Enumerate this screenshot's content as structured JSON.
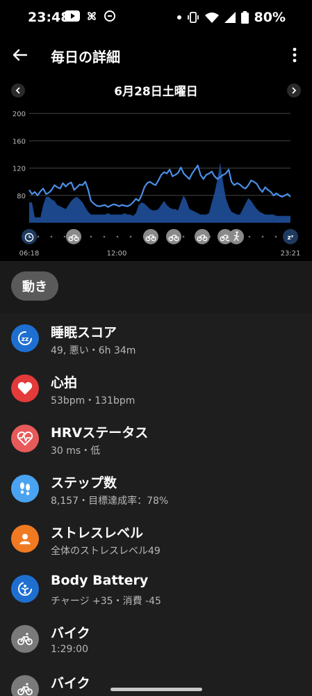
{
  "status_bar": {
    "time": "23:48",
    "battery": "80%"
  },
  "app_bar": {
    "title": "毎日の詳細"
  },
  "date": {
    "label": "6月28日土曜日"
  },
  "chart_data": {
    "type": "area",
    "y_ticks": [
      "200",
      "160",
      "120",
      "80"
    ],
    "ylim": [
      40,
      200
    ],
    "x_labels": [
      "06:18",
      "12:00",
      "23:21"
    ],
    "grid": true,
    "series": [
      {
        "values": [
          88,
          82,
          85,
          80,
          86,
          90,
          82,
          84,
          88,
          95,
          92,
          90,
          98,
          93,
          97,
          99,
          88,
          92,
          96,
          95,
          100,
          88,
          72,
          68,
          65,
          64,
          65,
          66,
          63,
          65,
          67,
          66,
          64,
          66,
          65,
          64,
          66,
          70,
          75,
          72,
          80,
          92,
          98,
          100,
          97,
          95,
          102,
          110,
          114,
          112,
          118,
          108,
          110,
          113,
          121,
          112,
          108,
          104,
          112,
          118,
          124,
          110,
          104,
          110,
          112,
          115,
          108,
          104,
          107,
          110,
          112,
          118,
          100,
          95,
          98,
          96,
          92,
          90,
          95,
          102,
          100,
          97,
          90,
          85,
          92,
          88,
          85,
          80,
          83,
          80,
          78,
          80,
          82,
          78
        ]
      },
      {
        "values": [
          70,
          70,
          48,
          48,
          48,
          66,
          78,
          78,
          74,
          72,
          66,
          64,
          62,
          60,
          66,
          72,
          76,
          78,
          74,
          70,
          62,
          56,
          52,
          52,
          52,
          52,
          52,
          52,
          54,
          52,
          52,
          52,
          52,
          52,
          54,
          52,
          52,
          50,
          54,
          66,
          70,
          68,
          64,
          60,
          58,
          58,
          60,
          66,
          72,
          66,
          62,
          60,
          60,
          58,
          70,
          80,
          72,
          60,
          58,
          56,
          54,
          52,
          52,
          52,
          54,
          70,
          84,
          104,
          128,
          100,
          76,
          64,
          56,
          54,
          52,
          52,
          60,
          68,
          76,
          72,
          66,
          60,
          56,
          54,
          52,
          52,
          52,
          52,
          50,
          50,
          50,
          50,
          50,
          50
        ]
      }
    ]
  },
  "activity_icons": [
    "alarm-icon",
    "bike-icon",
    "bike-icon",
    "bike-icon",
    "bike-icon",
    "bike-icon",
    "walk-icon",
    "sleep-icon"
  ],
  "tab": {
    "label": "動き"
  },
  "items": [
    {
      "label": "睡眠スコア",
      "sub": "49, 悪い・6h 34m",
      "icon": "sleep-score-icon",
      "color": "#1f6fd1"
    },
    {
      "label": "心拍",
      "sub": "53bpm・131bpm",
      "icon": "heart-icon",
      "color": "#e33a3a"
    },
    {
      "label": "HRVステータス",
      "sub": "30 ms・低",
      "icon": "hrv-icon",
      "color": "#e85a5a"
    },
    {
      "label": "ステップ数",
      "sub": "8,157・目標達成率：78%",
      "icon": "footsteps-icon",
      "color": "#4aa3f0"
    },
    {
      "label": "ストレスレベル",
      "sub": "全体のストレスレベル49",
      "icon": "stress-icon",
      "color": "#f07a22"
    },
    {
      "label": "Body Battery",
      "sub": "チャージ +35・消費 -45",
      "icon": "body-battery-icon",
      "color": "#1f6fd1"
    },
    {
      "label": "バイク",
      "sub": "1:29:00",
      "icon": "bike-icon",
      "color": "#7a7a7a"
    },
    {
      "label": "バイク",
      "sub": "",
      "icon": "bike-icon",
      "color": "#7a7a7a"
    }
  ]
}
